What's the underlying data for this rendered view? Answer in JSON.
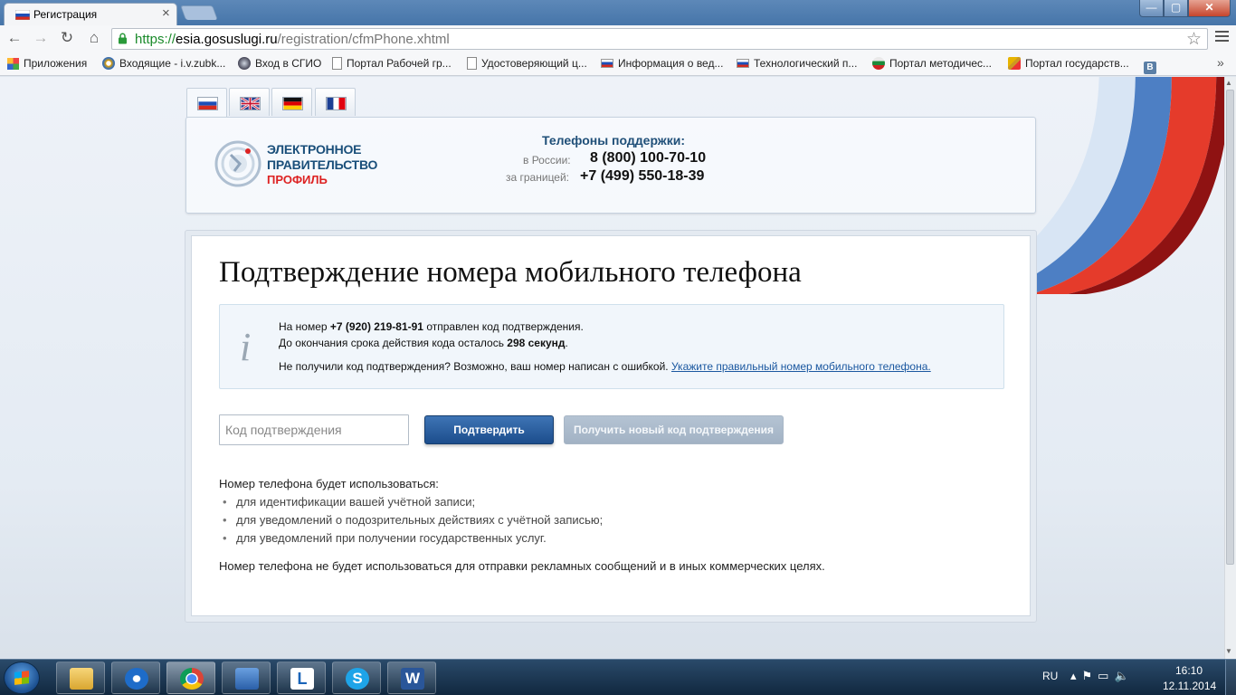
{
  "browser": {
    "tab_title": "Регистрация",
    "url_scheme": "https://",
    "url_host": "esia.gosuslugi.ru",
    "url_path": "/registration/cfmPhone.xhtml",
    "window_controls": {
      "minimize": "—",
      "maximize": "▢",
      "close": "✕"
    }
  },
  "bookmarks": [
    {
      "label": "Приложения",
      "icon": "apps-grid-icon"
    },
    {
      "label": "Входящие - i.v.zubk...",
      "icon": "mail-icon"
    },
    {
      "label": "Вход в СГИО",
      "icon": "globe-icon"
    },
    {
      "label": "Портал Рабочей гр...",
      "icon": "page-icon"
    },
    {
      "label": "Удостоверяющий ц...",
      "icon": "page-icon"
    },
    {
      "label": "Информация о вед...",
      "icon": "russia-flag-icon"
    },
    {
      "label": "Технологический п...",
      "icon": "russia-flag-icon"
    },
    {
      "label": "Портал методичес...",
      "icon": "globe-icon"
    },
    {
      "label": "Портал государств...",
      "icon": "emblem-icon"
    },
    {
      "label": "",
      "icon": "vk-icon"
    }
  ],
  "header": {
    "languages": [
      "ru",
      "en",
      "de",
      "fr"
    ],
    "logo_line1": "ЭЛЕКТРОННОЕ",
    "logo_line2": "ПРАВИТЕЛЬСТВО",
    "logo_line3": "ПРОФИЛЬ",
    "support_title": "Телефоны поддержки:",
    "russia_label": "в России:",
    "russia_phone": "8 (800) 100-70-10",
    "abroad_label": "за границей:",
    "abroad_phone": "+7 (499) 550-18-39"
  },
  "main": {
    "title": "Подтверждение номера мобильного телефона",
    "info": {
      "l1_prefix": "На номер ",
      "phone": "+7 (920) 219-81-91",
      "l1_suffix": " отправлен код подтверждения.",
      "l2_prefix": "До окончания срока действия кода осталось ",
      "seconds": "298 секунд",
      "l2_suffix": ".",
      "l3_text": "Не получили код подтверждения? Возможно, ваш номер написан с ошибкой. ",
      "l3_link": "Укажите правильный номер мобильного телефона."
    },
    "code_placeholder": "Код подтверждения",
    "confirm_label": "Подтвердить",
    "new_code_label": "Получить новый код подтверждения",
    "usage_title": "Номер телефона будет использоваться:",
    "usage_items": [
      "для идентификации вашей учётной записи;",
      "для уведомлений о подозрительных действиях с учётной записью;",
      "для уведомлений при получении государственных услуг."
    ],
    "usage_note": "Номер телефона не будет использоваться для отправки рекламных сообщений и в иных коммерческих целях."
  },
  "taskbar": {
    "apps": [
      "explorer",
      "teamviewer",
      "chrome",
      "archive",
      "lync",
      "skype",
      "word"
    ],
    "active_app": "chrome",
    "lang": "RU",
    "time": "16:10",
    "date": "12.11.2014"
  }
}
